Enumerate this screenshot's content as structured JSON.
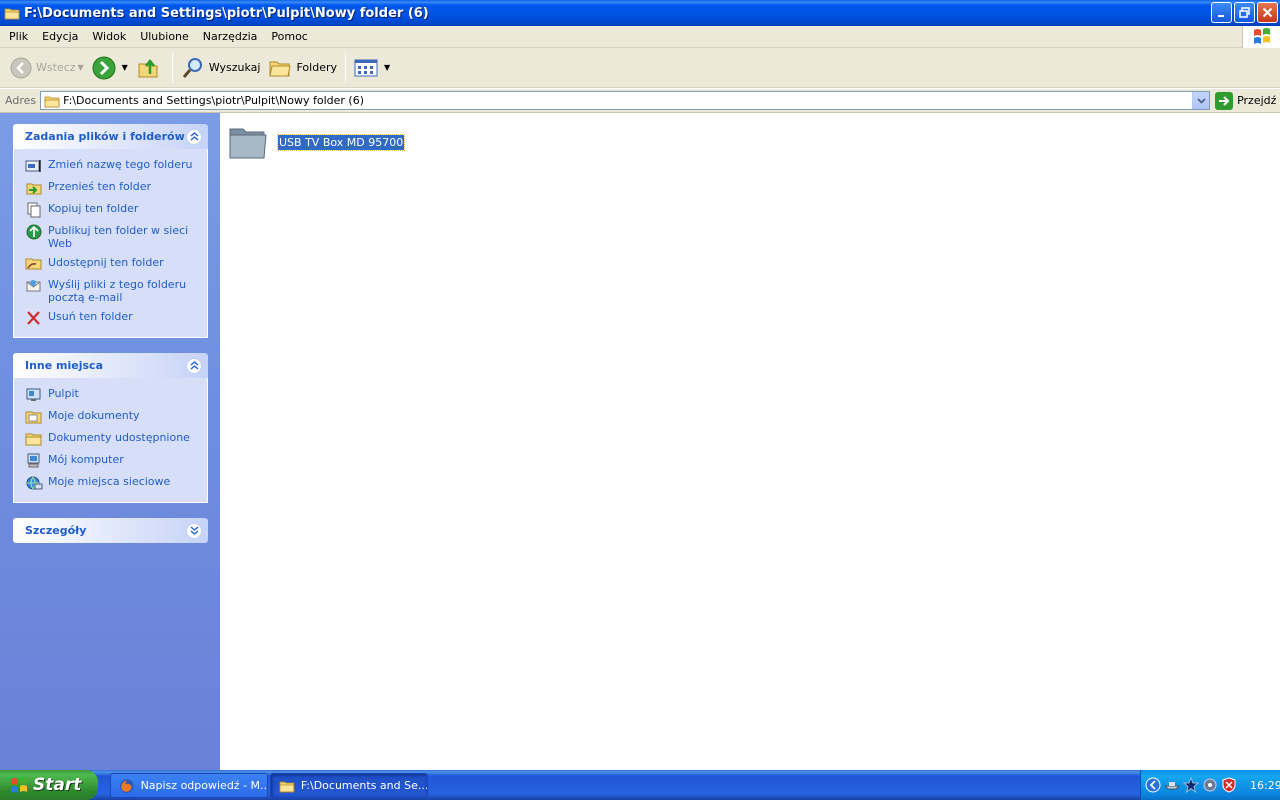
{
  "window": {
    "title": "F:\\Documents and Settings\\piotr\\Pulpit\\Nowy folder (6)"
  },
  "menu": [
    "Plik",
    "Edycja",
    "Widok",
    "Ulubione",
    "Narzędzia",
    "Pomoc"
  ],
  "toolbar": {
    "back_label": "Wstecz",
    "search_label": "Wyszukaj",
    "folders_label": "Foldery"
  },
  "address": {
    "label": "Adres",
    "path": "F:\\Documents and Settings\\piotr\\Pulpit\\Nowy folder (6)",
    "go_label": "Przejdź"
  },
  "taskpane": {
    "file_tasks": {
      "title": "Zadania plików i folderów",
      "items": [
        {
          "label": "Zmień nazwę tego folderu",
          "icon": "rename-icon"
        },
        {
          "label": "Przenieś ten folder",
          "icon": "move-icon"
        },
        {
          "label": "Kopiuj ten folder",
          "icon": "copy-icon"
        },
        {
          "label": "Publikuj ten folder w sieci Web",
          "icon": "publish-web-icon"
        },
        {
          "label": "Udostępnij ten folder",
          "icon": "share-icon"
        },
        {
          "label": "Wyślij pliki z tego folderu pocztą e-mail",
          "icon": "email-icon"
        },
        {
          "label": "Usuń ten folder",
          "icon": "delete-icon"
        }
      ]
    },
    "other_places": {
      "title": "Inne miejsca",
      "items": [
        {
          "label": "Pulpit",
          "icon": "desktop-icon"
        },
        {
          "label": "Moje dokumenty",
          "icon": "my-documents-icon"
        },
        {
          "label": "Dokumenty udostępnione",
          "icon": "shared-documents-icon"
        },
        {
          "label": "Mój komputer",
          "icon": "my-computer-icon"
        },
        {
          "label": "Moje miejsca sieciowe",
          "icon": "network-places-icon"
        }
      ]
    },
    "details": {
      "title": "Szczegóły"
    }
  },
  "content": {
    "items": [
      {
        "name": "USB TV Box MD 95700",
        "type": "folder",
        "selected": true
      }
    ]
  },
  "taskbar": {
    "start_label": "Start",
    "buttons": [
      {
        "label": "Napisz odpowiedź - M...",
        "icon": "firefox-icon",
        "active": false
      },
      {
        "label": "F:\\Documents and Se...",
        "icon": "folder-icon",
        "active": true
      }
    ],
    "clock": "16:29"
  },
  "colors": {
    "title_bar": "#0054e3",
    "task_link": "#215dc6",
    "selection": "#316ac5",
    "start_button": "#3c9a3c"
  }
}
